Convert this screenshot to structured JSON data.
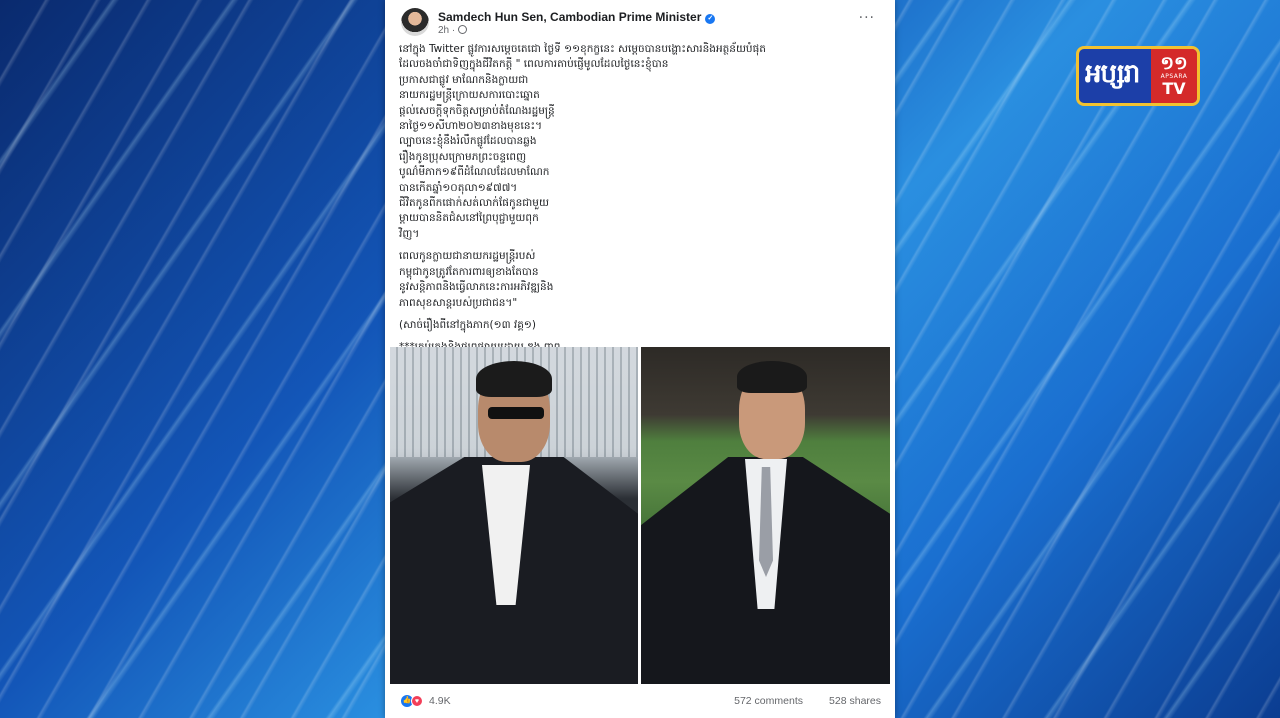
{
  "logo": {
    "main_text": "អប្សរា",
    "digits": "១១",
    "small_text": "APSARA",
    "tv_text": "TV"
  },
  "post": {
    "author": "Samdech Hun Sen, Cambodian Prime Minister",
    "time": "2h ·",
    "more_icon": "···",
    "paragraphs": [
      "នៅក្នុង Twitter ផ្លូវការសម្តេចតេជោ ថ្ងៃទី ១១ខុកក្ខនេះ សម្តេចបានបង្ហោះសារនិងអត្ថន័យបំផុត\nដែលចងចាំជាទិញក្នុងជីវិតកត្ដី \" ពេលការតាប់ផ្ញើមូលដែលថ្ងៃនេះខ្ញុំបាន\nប្រកាសជាផ្លូវ មាណែកនិងក្លាយជា\nនាយករដ្ឋមន្ត្រីក្រោយសការបោះឆ្នោត\nផ្តល់សេចក្តីទុកចិត្តសម្រាប់តំណែងរដ្ឋមន្ត្រី\nនាថ្ងៃ១១សីហា២០២៣ខាងមុខនេះ។\nល្បាចនេះខ្ញុំនឹងរំលឹកផ្លូវដែលបានឆ្លង\nរឿងកូនប្រុសក្រោមភព្រះចន្ទពេញ\nបូណ៌មីភាក១៩ពីដំណែលដែលមាណែក\nបានកើតឆ្នាំ១០តុលា១៩៧៧។\nជីវិតកូនពីកផោក់សត់លាក់ផែកូនជាមួយ\nម្តាយបាននិតជំសនៅព្រៃបុជ្ជាមួយពុក\nវិញ។",
      "ពេលកូនក្លាយជានាយករដ្ឋមន្ត្រីរបស់\nកម្ពុជាកូនត្រូវតែការពារឲ្យខាងតែបាន\nនូវសន្តិភាពនិងធ្វើលាភនេះការអភិវឌ្ឍនិង\nភាពសុខសាន្តរបស់ប្រជាជន។\"",
      "(សាច់រឿងពីនៅក្នុងភាក(១៣ វគ្គ១)",
      "***គ្រប់គ្រងនិងផ្សព្វផ្សាយដោយ ឌួង ពាព"
    ],
    "reactions": {
      "like_icon": "👍",
      "love_icon": "♥",
      "count": "4.9K"
    },
    "comments": "572 comments",
    "shares": "528 shares"
  }
}
